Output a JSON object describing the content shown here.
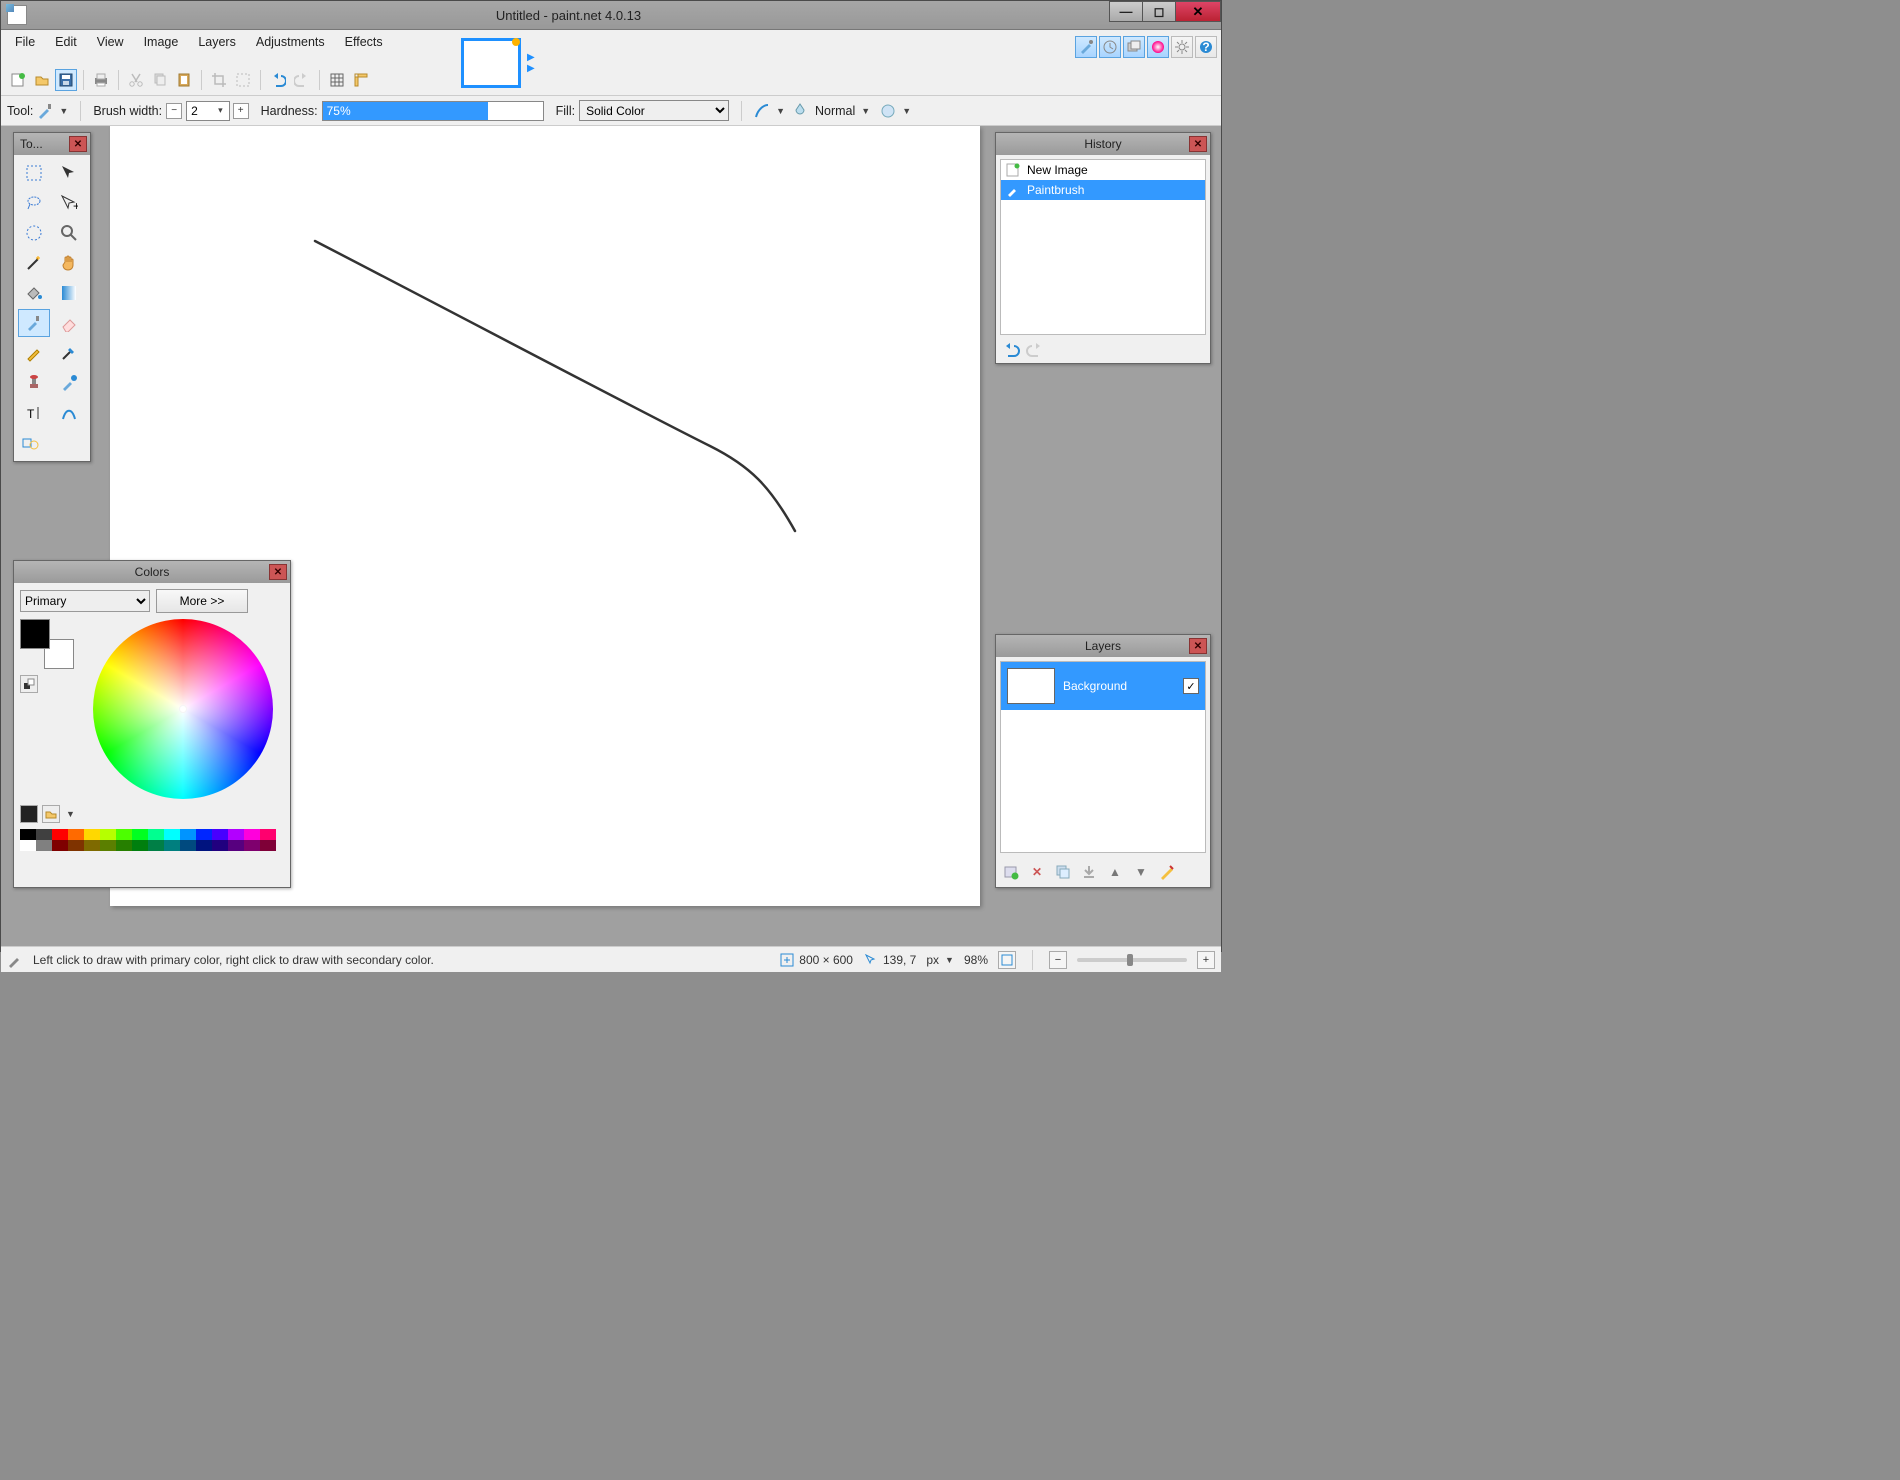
{
  "window": {
    "title": "Untitled - paint.net 4.0.13"
  },
  "menu": [
    "File",
    "Edit",
    "View",
    "Image",
    "Layers",
    "Adjustments",
    "Effects"
  ],
  "options": {
    "tool_label": "Tool:",
    "brushwidth_label": "Brush width:",
    "brushwidth_value": "2",
    "hardness_label": "Hardness:",
    "hardness_value": "75%",
    "fill_label": "Fill:",
    "fill_value": "Solid Color",
    "blend_value": "Normal"
  },
  "panels": {
    "tools_title": "To...",
    "history_title": "History",
    "colors_title": "Colors",
    "layers_title": "Layers"
  },
  "history": {
    "items": [
      {
        "label": "New Image"
      },
      {
        "label": "Paintbrush"
      }
    ]
  },
  "colors": {
    "selector": "Primary",
    "more": "More >>"
  },
  "layers": {
    "items": [
      {
        "label": "Background"
      }
    ]
  },
  "status": {
    "tip": "Left click to draw with primary color, right click to draw with secondary color.",
    "size": "800 × 600",
    "coords": "139, 7",
    "unit": "px",
    "zoom": "98%"
  },
  "palette": [
    "#000000",
    "#404040",
    "#ff0000",
    "#ff6a00",
    "#ffd800",
    "#b6ff00",
    "#4cff00",
    "#00ff21",
    "#00ff90",
    "#00ffff",
    "#0094ff",
    "#0026ff",
    "#4800ff",
    "#b200ff",
    "#ff00dc",
    "#ff006e",
    "#ffffff",
    "#808080",
    "#7f0000",
    "#7f3300",
    "#7f6a00",
    "#5b7f00",
    "#267f00",
    "#007f0e",
    "#007f46",
    "#007f7f",
    "#004a7f",
    "#00137f",
    "#21007f",
    "#57007f",
    "#7f006e",
    "#7f0037"
  ]
}
